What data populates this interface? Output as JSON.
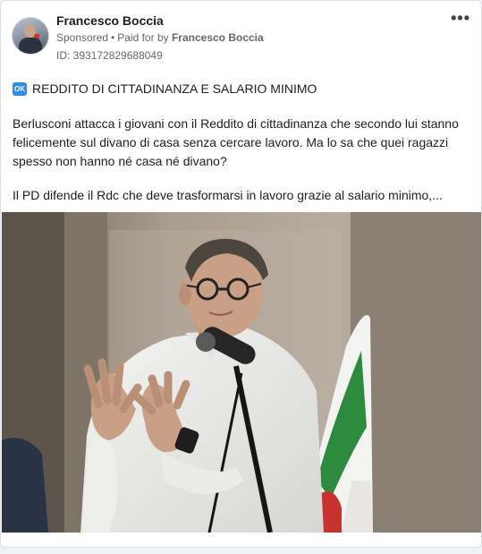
{
  "post": {
    "author_name": "Francesco Boccia",
    "sponsored_label": "Sponsored",
    "separator": "•",
    "paid_for_prefix": "Paid for by",
    "paid_for_name": "Francesco Boccia",
    "ad_id": "ID: 393172829688049",
    "more_icon": "more-horizontal-icon",
    "headline_icon": "ok-button-emoji",
    "headline_icon_text": "OK",
    "headline": "REDDITO DI CITTADINANZA E SALARIO MINIMO",
    "paragraphs": [
      "Berlusconi attacca i giovani con il Reddito di cittadinanza che secondo lui stanno felicemente sul divano di casa senza cercare lavoro. Ma lo sa che quei ragazzi spesso non hanno né casa né divano?",
      "Il PD difende il Rdc che deve trasformarsi in lavoro grazie al salario minimo,..."
    ]
  },
  "colors": {
    "accent_blue": "#2f8ee3",
    "text": "#1c1e21",
    "secondary_text": "#65676b"
  }
}
